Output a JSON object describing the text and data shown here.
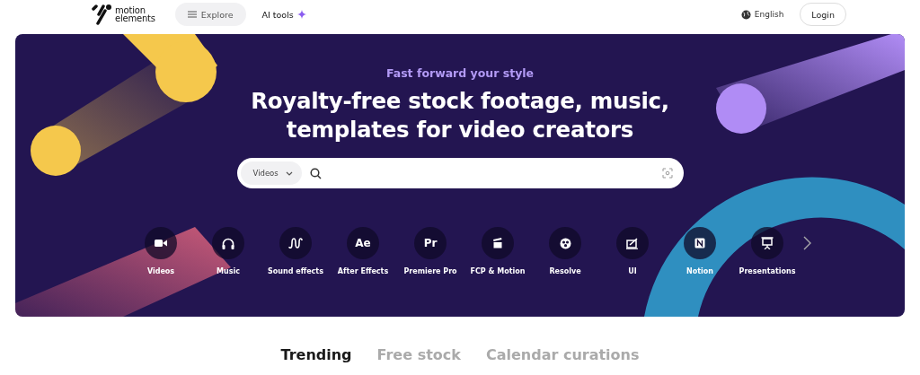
{
  "header": {
    "logo": [
      "motion",
      "elements"
    ],
    "explore": "Explore",
    "ai_tools": "AI tools",
    "language": "English",
    "login": "Login"
  },
  "hero": {
    "tagline": "Fast forward your style",
    "title": "Royalty-free stock footage, music,\ntemplates for video creators",
    "search": {
      "category": "Videos"
    },
    "categories": [
      {
        "label": "Videos"
      },
      {
        "label": "Music"
      },
      {
        "label": "Sound effects"
      },
      {
        "label": "After Effects",
        "icon_text": "Ae"
      },
      {
        "label": "Premiere Pro",
        "icon_text": "Pr"
      },
      {
        "label": "FCP & Motion"
      },
      {
        "label": "Resolve"
      },
      {
        "label": "UI"
      },
      {
        "label": "Notion"
      },
      {
        "label": "Presentations"
      }
    ]
  },
  "tabs": [
    {
      "label": "Trending",
      "selected": true
    },
    {
      "label": "Free stock",
      "selected": false
    },
    {
      "label": "Calendar curations",
      "selected": false
    }
  ]
}
